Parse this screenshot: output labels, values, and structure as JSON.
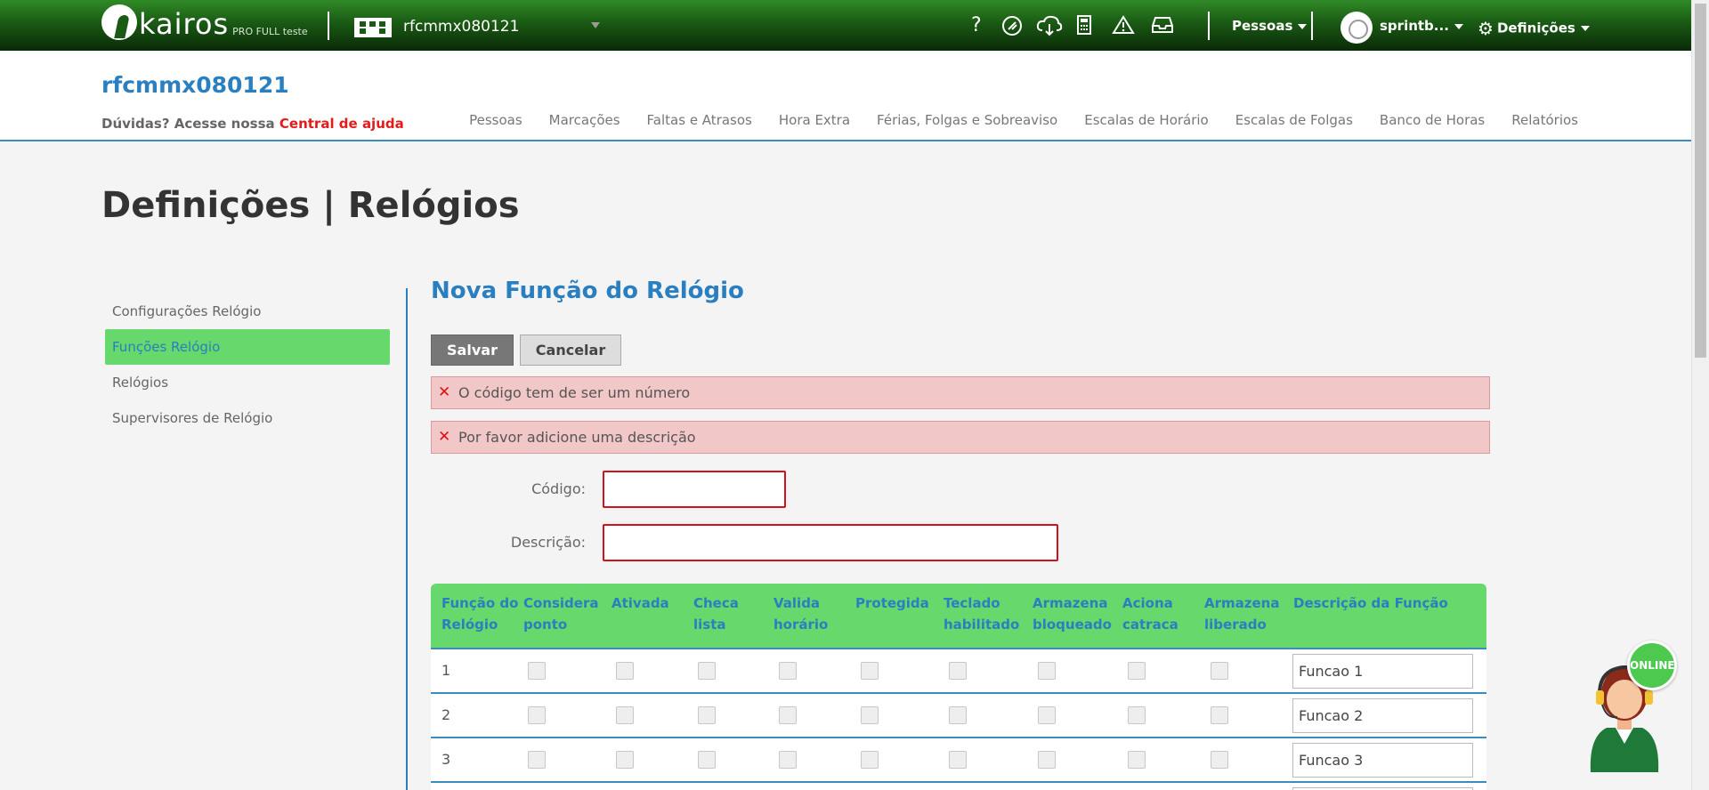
{
  "topbar": {
    "logo_text": "kairos",
    "logo_sub": "PRO FULL teste",
    "company_name": "rfcmmx080121",
    "icons": [
      "help-icon",
      "moon-icon",
      "cloud-download-icon",
      "calculator-icon",
      "warning-icon",
      "inbox-icon"
    ],
    "menu_people": "Pessoas",
    "user_name": "sprintb...",
    "settings_label": "Definições"
  },
  "header": {
    "company_title": "rfcmmx080121",
    "help_prefix": "Dúvidas? Acesse nossa",
    "help_link": "Central de ajuda",
    "nav": [
      "Pessoas",
      "Marcações",
      "Faltas e Atrasos",
      "Hora Extra",
      "Férias, Folgas e Sobreaviso",
      "Escalas de Horário",
      "Escalas de Folgas",
      "Banco de Horas",
      "Relatórios"
    ]
  },
  "page_title": "Definições | Relógios",
  "sidebar": {
    "items": [
      {
        "label": "Configurações Relógio",
        "active": false
      },
      {
        "label": "Funções Relógio",
        "active": true
      },
      {
        "label": "Relógios",
        "active": false
      },
      {
        "label": "Supervisores de Relógio",
        "active": false
      }
    ]
  },
  "main": {
    "section_title": "Nova Função do Relógio",
    "save_label": "Salvar",
    "cancel_label": "Cancelar",
    "errors": [
      "O código tem de ser um número",
      "Por favor adicione uma descrição"
    ],
    "code_label": "Código:",
    "code_value": "",
    "desc_label": "Descrição:",
    "desc_value": ""
  },
  "table": {
    "headers": [
      [
        "Função do",
        "Relógio"
      ],
      [
        "Considera",
        "ponto"
      ],
      [
        "Ativada"
      ],
      [
        "Checa",
        "lista"
      ],
      [
        "Valida",
        "horário"
      ],
      [
        "Protegida"
      ],
      [
        "Teclado",
        "habilitado"
      ],
      [
        "Armazena",
        "bloqueado"
      ],
      [
        "Aciona",
        "catraca"
      ],
      [
        "Armazena",
        "liberado"
      ],
      [
        "Descrição da Função"
      ]
    ],
    "rows": [
      {
        "num": "1",
        "desc": "Funcao 1"
      },
      {
        "num": "2",
        "desc": "Funcao 2"
      },
      {
        "num": "3",
        "desc": "Funcao 3"
      }
    ]
  },
  "support": {
    "online_label": "ONLINE"
  },
  "colors": {
    "brand_green": "#67d86c",
    "brand_blue": "#2a7fc0",
    "error_red": "#d1111d",
    "topbar_dark": "#0a2a08"
  }
}
